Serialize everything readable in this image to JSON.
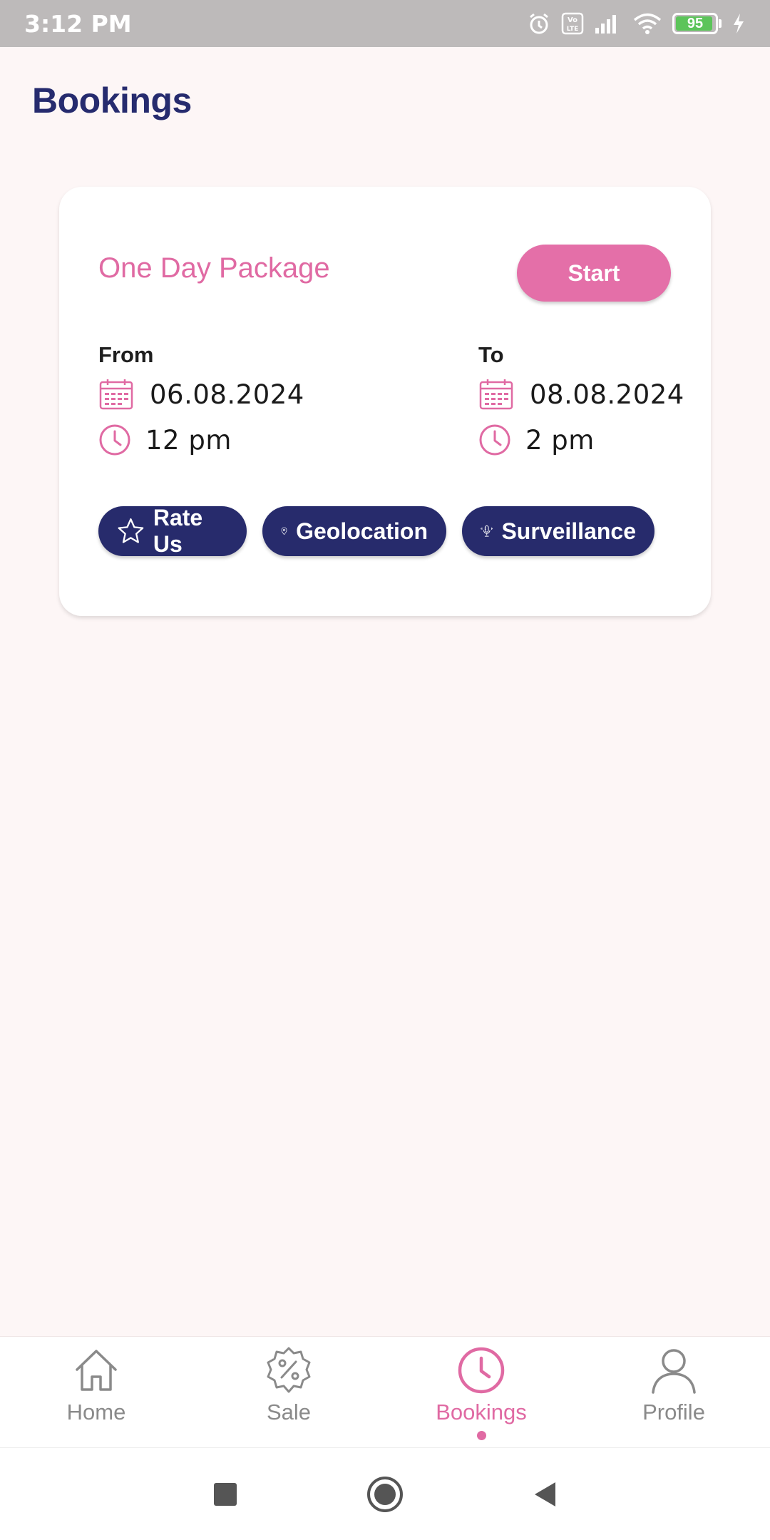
{
  "status_bar": {
    "time": "3:12 PM",
    "battery_level": "95",
    "icons": [
      "alarm-icon",
      "volte-icon",
      "signal-icon",
      "wifi-icon",
      "battery-icon",
      "charging-icon"
    ]
  },
  "page": {
    "title": "Bookings"
  },
  "booking": {
    "package_name": "One Day Package",
    "start_label": "Start",
    "from": {
      "label": "From",
      "date": "06.08.2024",
      "time": "12 pm"
    },
    "to": {
      "label": "To",
      "date": "08.08.2024",
      "time": "2 pm"
    },
    "actions": [
      {
        "label": "Rate Us",
        "icon": "star-icon"
      },
      {
        "label": "Geolocation",
        "icon": "location-pin-icon"
      },
      {
        "label": "Surveillance",
        "icon": "microphone-icon"
      }
    ]
  },
  "bottom_nav": {
    "items": [
      {
        "label": "Home",
        "icon": "home-icon",
        "active": false
      },
      {
        "label": "Sale",
        "icon": "sale-badge-icon",
        "active": false
      },
      {
        "label": "Bookings",
        "icon": "clock-icon",
        "active": true
      },
      {
        "label": "Profile",
        "icon": "user-icon",
        "active": false
      }
    ]
  },
  "colors": {
    "primary_navy": "#272b6c",
    "accent_pink": "#e06aa3",
    "background": "#fdf6f6",
    "inactive_gray": "#8a8a8a"
  }
}
